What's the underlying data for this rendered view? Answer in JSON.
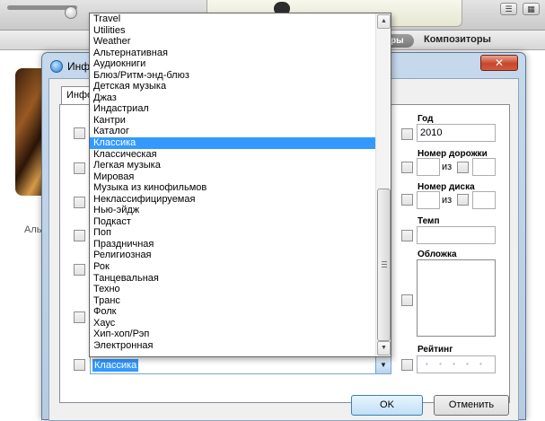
{
  "itunes": {
    "composers_tab": "Композиторы",
    "segment_tail": "ры",
    "album_label_fragment": "Аль"
  },
  "dialog": {
    "title": "Инф",
    "close_label": "✕",
    "tab_label": "Инфо",
    "year_label": "Год",
    "year_value": "2010",
    "track_number_label": "Номер дорожки",
    "disc_number_label": "Номер диска",
    "of_label": "из",
    "bpm_label": "Темп",
    "artwork_label": "Обложка",
    "rating_label": "Рейтинг",
    "rating_dots": "• • • • •",
    "genre_value": "Классика",
    "ok_label": "OK",
    "cancel_label": "Отменить"
  },
  "genre_dropdown": {
    "selected": "Классика",
    "items": [
      "Travel",
      "Utilities",
      "Weather",
      "Альтернативная",
      "Аудиокниги",
      "Блюз/Ритм-энд-блюз",
      "Детская музыка",
      "Джаз",
      "Индастриал",
      "Кантри",
      "Каталог",
      "Классика",
      "Классическая",
      "Легкая музыка",
      "Мировая",
      "Музыка из кинофильмов",
      "Неклассифицируемая",
      "Нью-эйдж",
      "Подкаст",
      "Поп",
      "Праздничная",
      "Религиозная",
      "Рок",
      "Танцевальная",
      "Техно",
      "Транс",
      "Фолк",
      "Хаус",
      "Хип-хоп/Рэп",
      "Электронная"
    ]
  }
}
